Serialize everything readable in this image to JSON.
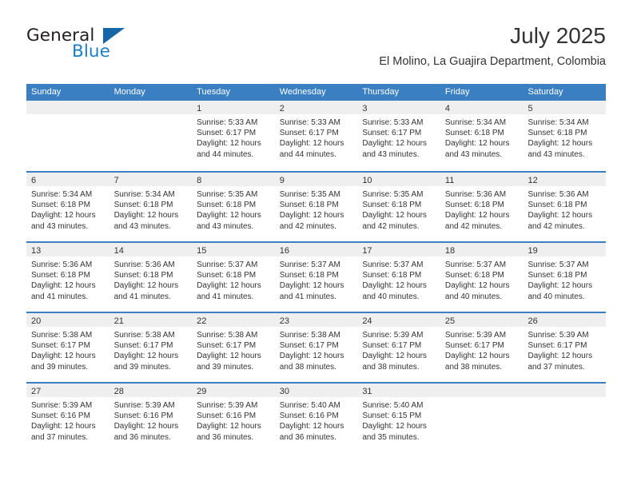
{
  "brand": {
    "name_part1": "General",
    "name_part2": "Blue",
    "accent_color": "#1c7fc4",
    "triangle_color": "#1566a8"
  },
  "header": {
    "month_title": "July 2025",
    "location": "El Molino, La Guajira Department, Colombia"
  },
  "calendar": {
    "header_color": "#3a7fc1",
    "weekdays": [
      "Sunday",
      "Monday",
      "Tuesday",
      "Wednesday",
      "Thursday",
      "Friday",
      "Saturday"
    ],
    "weeks": [
      [
        {
          "day": "",
          "lines": []
        },
        {
          "day": "",
          "lines": []
        },
        {
          "day": "1",
          "lines": [
            "Sunrise: 5:33 AM",
            "Sunset: 6:17 PM",
            "Daylight: 12 hours",
            "and 44 minutes."
          ]
        },
        {
          "day": "2",
          "lines": [
            "Sunrise: 5:33 AM",
            "Sunset: 6:17 PM",
            "Daylight: 12 hours",
            "and 44 minutes."
          ]
        },
        {
          "day": "3",
          "lines": [
            "Sunrise: 5:33 AM",
            "Sunset: 6:17 PM",
            "Daylight: 12 hours",
            "and 43 minutes."
          ]
        },
        {
          "day": "4",
          "lines": [
            "Sunrise: 5:34 AM",
            "Sunset: 6:18 PM",
            "Daylight: 12 hours",
            "and 43 minutes."
          ]
        },
        {
          "day": "5",
          "lines": [
            "Sunrise: 5:34 AM",
            "Sunset: 6:18 PM",
            "Daylight: 12 hours",
            "and 43 minutes."
          ]
        }
      ],
      [
        {
          "day": "6",
          "lines": [
            "Sunrise: 5:34 AM",
            "Sunset: 6:18 PM",
            "Daylight: 12 hours",
            "and 43 minutes."
          ]
        },
        {
          "day": "7",
          "lines": [
            "Sunrise: 5:34 AM",
            "Sunset: 6:18 PM",
            "Daylight: 12 hours",
            "and 43 minutes."
          ]
        },
        {
          "day": "8",
          "lines": [
            "Sunrise: 5:35 AM",
            "Sunset: 6:18 PM",
            "Daylight: 12 hours",
            "and 43 minutes."
          ]
        },
        {
          "day": "9",
          "lines": [
            "Sunrise: 5:35 AM",
            "Sunset: 6:18 PM",
            "Daylight: 12 hours",
            "and 42 minutes."
          ]
        },
        {
          "day": "10",
          "lines": [
            "Sunrise: 5:35 AM",
            "Sunset: 6:18 PM",
            "Daylight: 12 hours",
            "and 42 minutes."
          ]
        },
        {
          "day": "11",
          "lines": [
            "Sunrise: 5:36 AM",
            "Sunset: 6:18 PM",
            "Daylight: 12 hours",
            "and 42 minutes."
          ]
        },
        {
          "day": "12",
          "lines": [
            "Sunrise: 5:36 AM",
            "Sunset: 6:18 PM",
            "Daylight: 12 hours",
            "and 42 minutes."
          ]
        }
      ],
      [
        {
          "day": "13",
          "lines": [
            "Sunrise: 5:36 AM",
            "Sunset: 6:18 PM",
            "Daylight: 12 hours",
            "and 41 minutes."
          ]
        },
        {
          "day": "14",
          "lines": [
            "Sunrise: 5:36 AM",
            "Sunset: 6:18 PM",
            "Daylight: 12 hours",
            "and 41 minutes."
          ]
        },
        {
          "day": "15",
          "lines": [
            "Sunrise: 5:37 AM",
            "Sunset: 6:18 PM",
            "Daylight: 12 hours",
            "and 41 minutes."
          ]
        },
        {
          "day": "16",
          "lines": [
            "Sunrise: 5:37 AM",
            "Sunset: 6:18 PM",
            "Daylight: 12 hours",
            "and 41 minutes."
          ]
        },
        {
          "day": "17",
          "lines": [
            "Sunrise: 5:37 AM",
            "Sunset: 6:18 PM",
            "Daylight: 12 hours",
            "and 40 minutes."
          ]
        },
        {
          "day": "18",
          "lines": [
            "Sunrise: 5:37 AM",
            "Sunset: 6:18 PM",
            "Daylight: 12 hours",
            "and 40 minutes."
          ]
        },
        {
          "day": "19",
          "lines": [
            "Sunrise: 5:37 AM",
            "Sunset: 6:18 PM",
            "Daylight: 12 hours",
            "and 40 minutes."
          ]
        }
      ],
      [
        {
          "day": "20",
          "lines": [
            "Sunrise: 5:38 AM",
            "Sunset: 6:17 PM",
            "Daylight: 12 hours",
            "and 39 minutes."
          ]
        },
        {
          "day": "21",
          "lines": [
            "Sunrise: 5:38 AM",
            "Sunset: 6:17 PM",
            "Daylight: 12 hours",
            "and 39 minutes."
          ]
        },
        {
          "day": "22",
          "lines": [
            "Sunrise: 5:38 AM",
            "Sunset: 6:17 PM",
            "Daylight: 12 hours",
            "and 39 minutes."
          ]
        },
        {
          "day": "23",
          "lines": [
            "Sunrise: 5:38 AM",
            "Sunset: 6:17 PM",
            "Daylight: 12 hours",
            "and 38 minutes."
          ]
        },
        {
          "day": "24",
          "lines": [
            "Sunrise: 5:39 AM",
            "Sunset: 6:17 PM",
            "Daylight: 12 hours",
            "and 38 minutes."
          ]
        },
        {
          "day": "25",
          "lines": [
            "Sunrise: 5:39 AM",
            "Sunset: 6:17 PM",
            "Daylight: 12 hours",
            "and 38 minutes."
          ]
        },
        {
          "day": "26",
          "lines": [
            "Sunrise: 5:39 AM",
            "Sunset: 6:17 PM",
            "Daylight: 12 hours",
            "and 37 minutes."
          ]
        }
      ],
      [
        {
          "day": "27",
          "lines": [
            "Sunrise: 5:39 AM",
            "Sunset: 6:16 PM",
            "Daylight: 12 hours",
            "and 37 minutes."
          ]
        },
        {
          "day": "28",
          "lines": [
            "Sunrise: 5:39 AM",
            "Sunset: 6:16 PM",
            "Daylight: 12 hours",
            "and 36 minutes."
          ]
        },
        {
          "day": "29",
          "lines": [
            "Sunrise: 5:39 AM",
            "Sunset: 6:16 PM",
            "Daylight: 12 hours",
            "and 36 minutes."
          ]
        },
        {
          "day": "30",
          "lines": [
            "Sunrise: 5:40 AM",
            "Sunset: 6:16 PM",
            "Daylight: 12 hours",
            "and 36 minutes."
          ]
        },
        {
          "day": "31",
          "lines": [
            "Sunrise: 5:40 AM",
            "Sunset: 6:15 PM",
            "Daylight: 12 hours",
            "and 35 minutes."
          ]
        },
        {
          "day": "",
          "lines": []
        },
        {
          "day": "",
          "lines": []
        }
      ]
    ]
  }
}
